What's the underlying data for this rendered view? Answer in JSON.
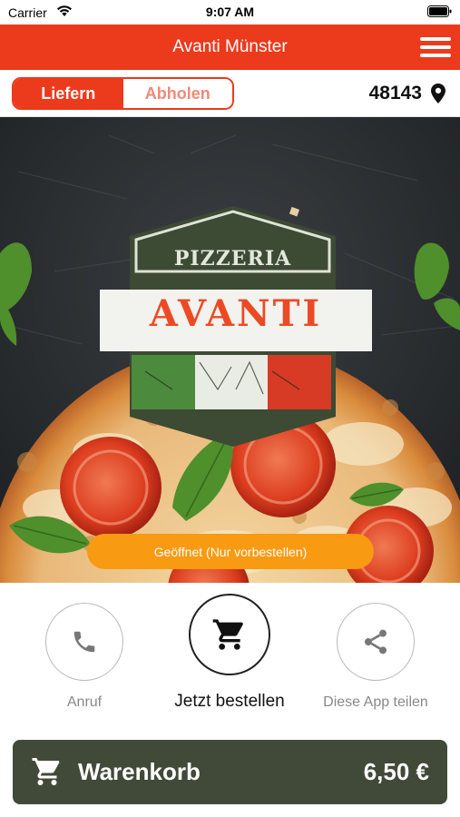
{
  "status_bar": {
    "carrier": "Carrier",
    "time": "9:07 AM"
  },
  "header": {
    "title": "Avanti Münster"
  },
  "mode": {
    "deliver_label": "Liefern",
    "pickup_label": "Abholen",
    "active": "deliver"
  },
  "location": {
    "zip": "48143"
  },
  "hero": {
    "logo_top": "PIZZERIA",
    "logo_name": "AVANTI",
    "status_pill": "Geöffnet (Nur vorbestellen)"
  },
  "actions": {
    "call_label": "Anruf",
    "order_label": "Jetzt bestellen",
    "share_label": "Diese App teilen"
  },
  "cart": {
    "label": "Warenkorb",
    "total": "6,50 €"
  },
  "colors": {
    "brand_red": "#ec3a1c",
    "status_orange": "#f89a12",
    "cart_green": "#414a38",
    "logo_green": "#3d4a34"
  },
  "icons": [
    "wifi-icon",
    "battery-icon",
    "menu-icon",
    "location-pin-icon",
    "phone-icon",
    "shopping-cart-icon",
    "share-icon"
  ]
}
